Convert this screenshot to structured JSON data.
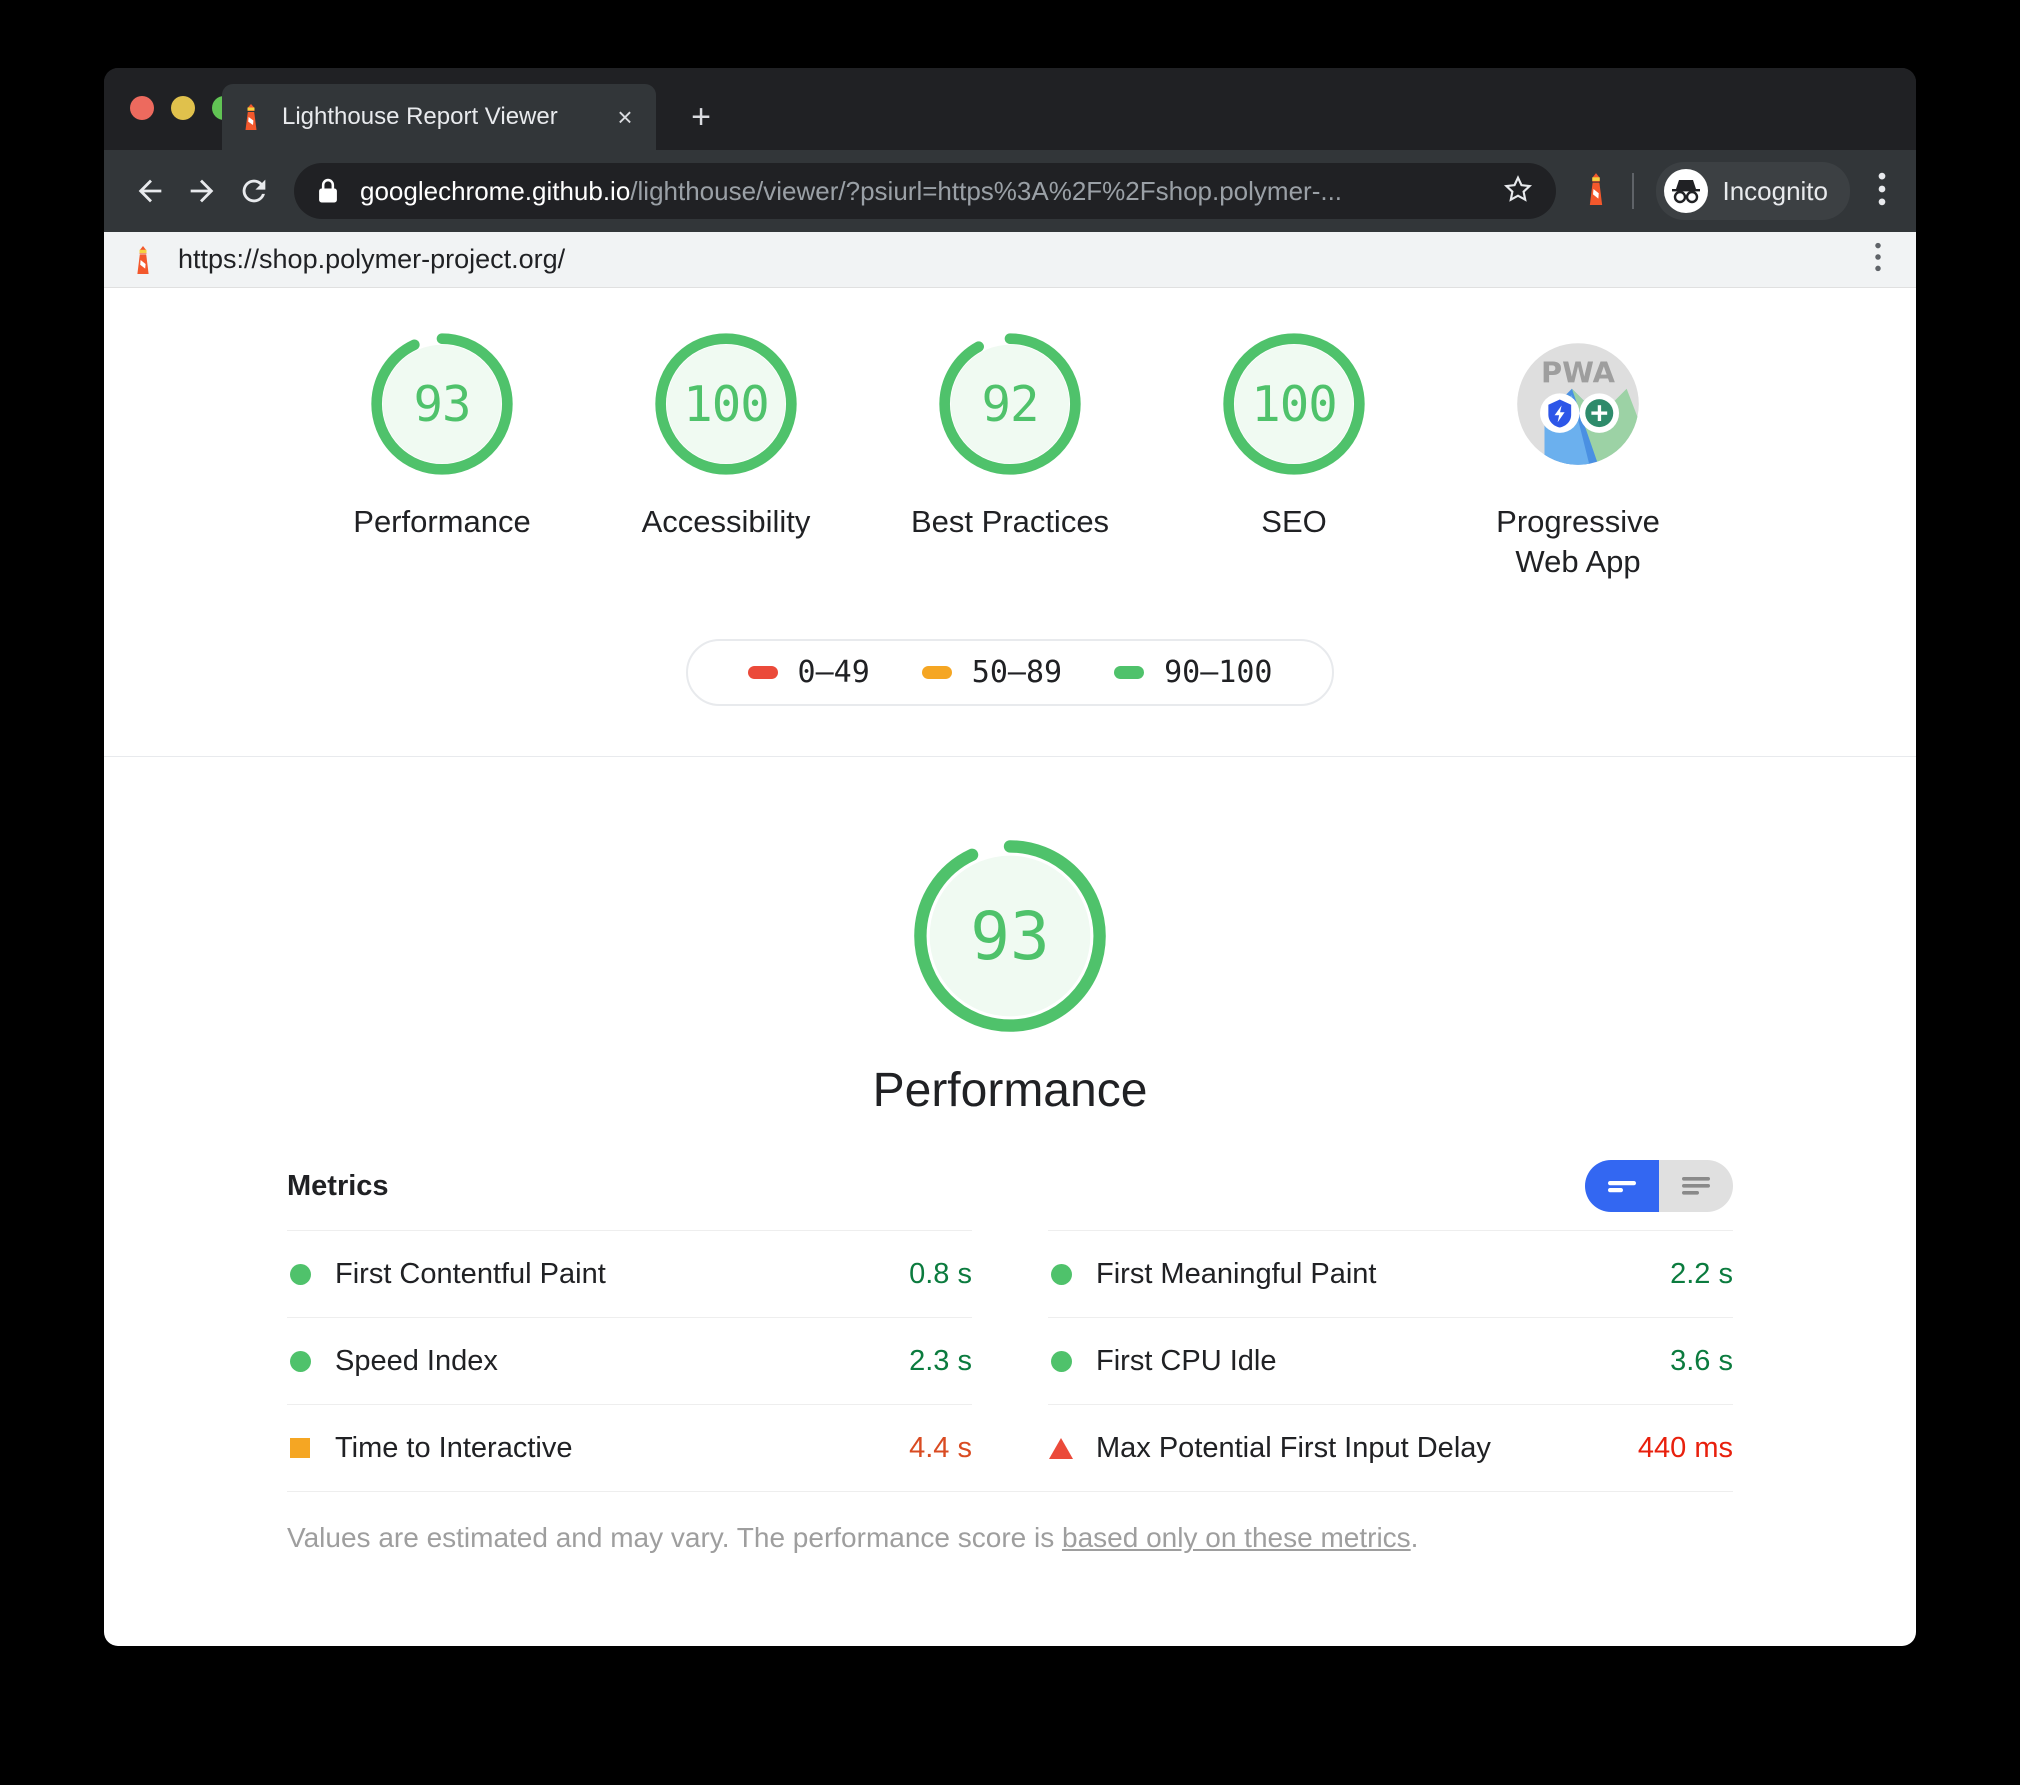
{
  "browser": {
    "tab": {
      "title": "Lighthouse Report Viewer",
      "favicon": "lighthouse-icon",
      "close_label": "×"
    },
    "new_tab_label": "+",
    "nav": {
      "back": "back-arrow-icon",
      "forward": "forward-arrow-icon",
      "reload": "reload-icon"
    },
    "omnibox": {
      "lock": "lock-icon",
      "host": "googlechrome.github.io",
      "path": "/lighthouse/viewer/?psiurl=https%3A%2F%2Fshop.polymer-...",
      "full_url": "googlechrome.github.io/lighthouse/viewer/?psiurl=https%3A%2F%2Fshop.polymer-...",
      "star": "bookmark-star-icon"
    },
    "extension_icon": "lighthouse-extension-icon",
    "profile": {
      "label": "Incognito",
      "icon": "incognito-icon"
    },
    "menu_label": "⋮"
  },
  "page_header": {
    "favicon": "lighthouse-icon",
    "url": "https://shop.polymer-project.org/",
    "menu_label": "⋮"
  },
  "scores": [
    {
      "value": "93",
      "label": "Performance",
      "percent": 93,
      "color": "#4FC26B",
      "type": "gauge"
    },
    {
      "value": "100",
      "label": "Accessibility",
      "percent": 100,
      "color": "#4FC26B",
      "type": "gauge"
    },
    {
      "value": "92",
      "label": "Best Practices",
      "percent": 92,
      "color": "#4FC26B",
      "type": "gauge"
    },
    {
      "value": "100",
      "label": "SEO",
      "percent": 100,
      "color": "#4FC26B",
      "type": "gauge"
    },
    {
      "value": "",
      "label": "Progressive\nWeb App",
      "percent": 0,
      "color": "#dadce0",
      "type": "pwa",
      "badge_text": "PWA"
    }
  ],
  "legend": [
    {
      "color": "#EB4A3A",
      "range": "0–49"
    },
    {
      "color": "#F5A623",
      "range": "50–89"
    },
    {
      "color": "#4FC26B",
      "range": "90–100"
    }
  ],
  "hero": {
    "value": "93",
    "label": "Performance",
    "percent": 93,
    "color": "#4FC26B"
  },
  "metrics": {
    "title": "Metrics",
    "toggle": {
      "active": "simple-view",
      "options": [
        "simple-view",
        "detailed-view"
      ]
    },
    "left_column": [
      {
        "name": "First Contentful Paint",
        "value": "0.8 s",
        "status": "pass",
        "icon": "circle",
        "value_color": "green"
      },
      {
        "name": "Speed Index",
        "value": "2.3 s",
        "status": "pass",
        "icon": "circle",
        "value_color": "green"
      },
      {
        "name": "Time to Interactive",
        "value": "4.4 s",
        "status": "average",
        "icon": "square",
        "value_color": "orange"
      }
    ],
    "right_column": [
      {
        "name": "First Meaningful Paint",
        "value": "2.2 s",
        "status": "pass",
        "icon": "circle",
        "value_color": "green"
      },
      {
        "name": "First CPU Idle",
        "value": "3.6 s",
        "status": "pass",
        "icon": "circle",
        "value_color": "green"
      },
      {
        "name": "Max Potential First Input Delay",
        "value": "440 ms",
        "status": "fail",
        "icon": "triangle",
        "value_color": "red"
      }
    ],
    "footnote_prefix": "Values are estimated and may vary. The performance score is ",
    "footnote_link": "based only on these metrics",
    "footnote_suffix": "."
  },
  "colors": {
    "pass": "#4FC26B",
    "average": "#F5A623",
    "fail": "#EB4A3A",
    "accent_blue": "#3367F2",
    "gauge_fill": "#F0FAF2"
  }
}
